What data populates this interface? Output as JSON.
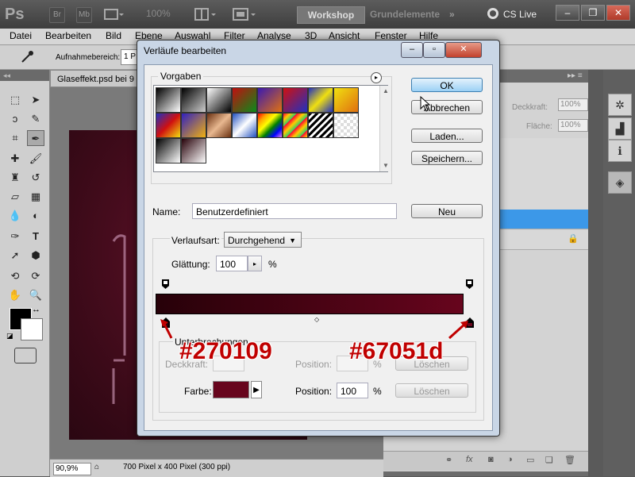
{
  "appbar": {
    "logo": "Ps",
    "br": "Br",
    "mb": "Mb",
    "zoom": "100%",
    "workspaces": [
      "Workshop",
      "Grundelemente"
    ],
    "more": "»",
    "cslive": "CS Live"
  },
  "menu": [
    "Datei",
    "Bearbeiten",
    "Bild",
    "Ebene",
    "Auswahl",
    "Filter",
    "Analyse",
    "3D",
    "Ansicht",
    "Fenster",
    "Hilfe"
  ],
  "options": {
    "sample_label": "Aufnahmebereich:",
    "sample_value": "1 P"
  },
  "document": {
    "tab": "Glaseffekt.psd bei 9",
    "zoom": "90,9%",
    "info": "700 Pixel x 400 Pixel (300 ppi)"
  },
  "layers": {
    "opacity_label": "Deckkraft:",
    "opacity_value": "100%",
    "fill_label": "Fläche:",
    "fill_value": "100%"
  },
  "dialog": {
    "title": "Verläufe bearbeiten",
    "presets_label": "Vorgaben",
    "buttons": {
      "ok": "OK",
      "cancel": "Abbrechen",
      "load": "Laden...",
      "save": "Speichern...",
      "new": "Neu"
    },
    "name_label": "Name:",
    "name_value": "Benutzerdefiniert",
    "type_label": "Verlaufsart:",
    "type_value": "Durchgehend",
    "smooth_label": "Glättung:",
    "smooth_value": "100",
    "smooth_unit": "%",
    "stops_label": "Unterbrechungen",
    "opacity_label": "Deckkraft:",
    "position_label": "Position:",
    "pct": "%",
    "delete_label": "Löschen",
    "color_label": "Farbe:",
    "color_position_value": "100",
    "stop_color": "#67051d",
    "gradient_start": "#270109",
    "gradient_end": "#67051d"
  },
  "annotations": {
    "left_color": "#270109",
    "right_color": "#67051d"
  }
}
